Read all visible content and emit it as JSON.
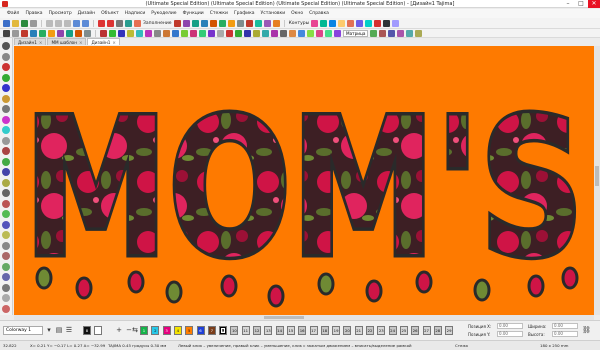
{
  "window": {
    "title": "(Ultimate Special Edition) (Ultimate Special Edition) (Ultimate Special Edition) (Ultimate Special Edition) - [Дизайн1 Tajima]",
    "min_glyph": "–",
    "max_glyph": "□",
    "close_glyph": "✕"
  },
  "menu": [
    "Файл",
    "Правка",
    "Просмотр",
    "Дизайн",
    "Объект",
    "Надписи",
    "Рукоделие",
    "Функции",
    "Стежки",
    "Графика",
    "Установки",
    "Окно",
    "Справка"
  ],
  "toolbar": {
    "zoom_label": "Заполнение",
    "contours_label": "Контуры",
    "stitch_type": "Матрица"
  },
  "tabs": [
    {
      "label": "Дизайн1",
      "close": "×",
      "active": false
    },
    {
      "label": "MM шаблон",
      "close": "×",
      "active": false
    },
    {
      "label": "Дизайн1",
      "close": "×",
      "active": true
    }
  ],
  "design": {
    "text": "MOM'S"
  },
  "palette": {
    "selector": "Colorway 1",
    "swatches": [
      {
        "color": "#111111",
        "label": "8"
      },
      {
        "color": "#ffffff",
        "label": ""
      },
      {
        "color": "#16b34a",
        "label": "1"
      },
      {
        "color": "#27c8e8",
        "label": "2"
      },
      {
        "color": "#e6007e",
        "label": "3"
      },
      {
        "color": "#f5e400",
        "label": "4"
      },
      {
        "color": "#ff7d00",
        "label": "5"
      },
      {
        "color": "#1e3fd8",
        "label": "6"
      },
      {
        "color": "#7a3d1a",
        "label": "7"
      },
      {
        "color": "#000000",
        "label": "D"
      },
      {
        "color": "#c6c6c6",
        "label": "10"
      },
      {
        "color": "#d6d6d6",
        "label": "11"
      },
      {
        "color": "#c6c6c6",
        "label": "12"
      },
      {
        "color": "#d6d6d6",
        "label": "13"
      },
      {
        "color": "#c6c6c6",
        "label": "14"
      },
      {
        "color": "#d6d6d6",
        "label": "15"
      },
      {
        "color": "#c6c6c6",
        "label": "16"
      },
      {
        "color": "#d6d6d6",
        "label": "17"
      },
      {
        "color": "#c6c6c6",
        "label": "18"
      },
      {
        "color": "#d6d6d6",
        "label": "19"
      },
      {
        "color": "#c6c6c6",
        "label": "20"
      },
      {
        "color": "#d6d6d6",
        "label": "21"
      },
      {
        "color": "#c6c6c6",
        "label": "22"
      },
      {
        "color": "#d6d6d6",
        "label": "23"
      },
      {
        "color": "#c6c6c6",
        "label": "24"
      },
      {
        "color": "#d6d6d6",
        "label": "25"
      },
      {
        "color": "#c6c6c6",
        "label": "26"
      },
      {
        "color": "#d6d6d6",
        "label": "27"
      },
      {
        "color": "#c6c6c6",
        "label": "28"
      },
      {
        "color": "#d6d6d6",
        "label": "29"
      }
    ],
    "position_x_label": "Позиция X:",
    "position_x": "0.00",
    "position_y_label": "Позиция Y:",
    "position_y": "0.00",
    "width_label": "Ширина:",
    "width": "0.00",
    "height_label": "Высота:",
    "height": "0.00"
  },
  "status": {
    "stitches": "32.822",
    "coords": "X= 0.21 Y= −0.17 L= 0.27 A= −32.99",
    "hoop": "TAJIMA  0.45 градусы  0.30 мм",
    "hint": "Левый клик – увеличение, правый клик – уменьшение, клик с зажатым движением – вписать/выделение рамкой",
    "mode": "Стежк",
    "size": "180 x 250 mm"
  },
  "colors": {
    "canvas": "#fe7a00",
    "fill": "#cf1446",
    "outline": "#2a2a2a",
    "foliage": "#5a6e2c",
    "tint": "#3d1f24"
  }
}
